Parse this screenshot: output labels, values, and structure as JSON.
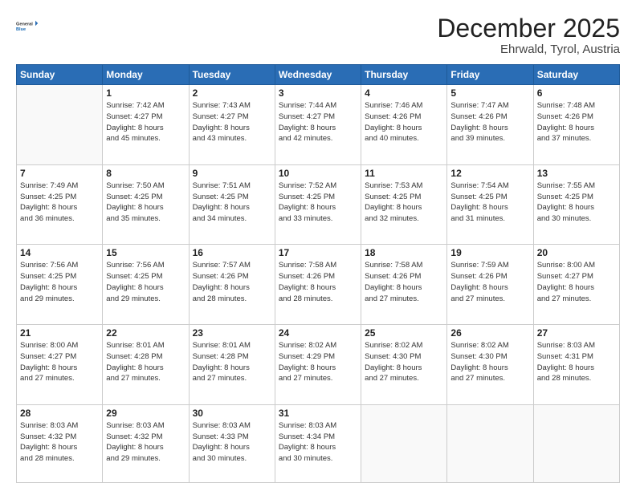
{
  "header": {
    "logo_line1": "General",
    "logo_line2": "Blue",
    "month_year": "December 2025",
    "location": "Ehrwald, Tyrol, Austria"
  },
  "weekdays": [
    "Sunday",
    "Monday",
    "Tuesday",
    "Wednesday",
    "Thursday",
    "Friday",
    "Saturday"
  ],
  "weeks": [
    [
      {
        "day": "",
        "info": ""
      },
      {
        "day": "1",
        "info": "Sunrise: 7:42 AM\nSunset: 4:27 PM\nDaylight: 8 hours\nand 45 minutes."
      },
      {
        "day": "2",
        "info": "Sunrise: 7:43 AM\nSunset: 4:27 PM\nDaylight: 8 hours\nand 43 minutes."
      },
      {
        "day": "3",
        "info": "Sunrise: 7:44 AM\nSunset: 4:27 PM\nDaylight: 8 hours\nand 42 minutes."
      },
      {
        "day": "4",
        "info": "Sunrise: 7:46 AM\nSunset: 4:26 PM\nDaylight: 8 hours\nand 40 minutes."
      },
      {
        "day": "5",
        "info": "Sunrise: 7:47 AM\nSunset: 4:26 PM\nDaylight: 8 hours\nand 39 minutes."
      },
      {
        "day": "6",
        "info": "Sunrise: 7:48 AM\nSunset: 4:26 PM\nDaylight: 8 hours\nand 37 minutes."
      }
    ],
    [
      {
        "day": "7",
        "info": "Sunrise: 7:49 AM\nSunset: 4:25 PM\nDaylight: 8 hours\nand 36 minutes."
      },
      {
        "day": "8",
        "info": "Sunrise: 7:50 AM\nSunset: 4:25 PM\nDaylight: 8 hours\nand 35 minutes."
      },
      {
        "day": "9",
        "info": "Sunrise: 7:51 AM\nSunset: 4:25 PM\nDaylight: 8 hours\nand 34 minutes."
      },
      {
        "day": "10",
        "info": "Sunrise: 7:52 AM\nSunset: 4:25 PM\nDaylight: 8 hours\nand 33 minutes."
      },
      {
        "day": "11",
        "info": "Sunrise: 7:53 AM\nSunset: 4:25 PM\nDaylight: 8 hours\nand 32 minutes."
      },
      {
        "day": "12",
        "info": "Sunrise: 7:54 AM\nSunset: 4:25 PM\nDaylight: 8 hours\nand 31 minutes."
      },
      {
        "day": "13",
        "info": "Sunrise: 7:55 AM\nSunset: 4:25 PM\nDaylight: 8 hours\nand 30 minutes."
      }
    ],
    [
      {
        "day": "14",
        "info": "Sunrise: 7:56 AM\nSunset: 4:25 PM\nDaylight: 8 hours\nand 29 minutes."
      },
      {
        "day": "15",
        "info": "Sunrise: 7:56 AM\nSunset: 4:25 PM\nDaylight: 8 hours\nand 29 minutes."
      },
      {
        "day": "16",
        "info": "Sunrise: 7:57 AM\nSunset: 4:26 PM\nDaylight: 8 hours\nand 28 minutes."
      },
      {
        "day": "17",
        "info": "Sunrise: 7:58 AM\nSunset: 4:26 PM\nDaylight: 8 hours\nand 28 minutes."
      },
      {
        "day": "18",
        "info": "Sunrise: 7:58 AM\nSunset: 4:26 PM\nDaylight: 8 hours\nand 27 minutes."
      },
      {
        "day": "19",
        "info": "Sunrise: 7:59 AM\nSunset: 4:26 PM\nDaylight: 8 hours\nand 27 minutes."
      },
      {
        "day": "20",
        "info": "Sunrise: 8:00 AM\nSunset: 4:27 PM\nDaylight: 8 hours\nand 27 minutes."
      }
    ],
    [
      {
        "day": "21",
        "info": "Sunrise: 8:00 AM\nSunset: 4:27 PM\nDaylight: 8 hours\nand 27 minutes."
      },
      {
        "day": "22",
        "info": "Sunrise: 8:01 AM\nSunset: 4:28 PM\nDaylight: 8 hours\nand 27 minutes."
      },
      {
        "day": "23",
        "info": "Sunrise: 8:01 AM\nSunset: 4:28 PM\nDaylight: 8 hours\nand 27 minutes."
      },
      {
        "day": "24",
        "info": "Sunrise: 8:02 AM\nSunset: 4:29 PM\nDaylight: 8 hours\nand 27 minutes."
      },
      {
        "day": "25",
        "info": "Sunrise: 8:02 AM\nSunset: 4:30 PM\nDaylight: 8 hours\nand 27 minutes."
      },
      {
        "day": "26",
        "info": "Sunrise: 8:02 AM\nSunset: 4:30 PM\nDaylight: 8 hours\nand 27 minutes."
      },
      {
        "day": "27",
        "info": "Sunrise: 8:03 AM\nSunset: 4:31 PM\nDaylight: 8 hours\nand 28 minutes."
      }
    ],
    [
      {
        "day": "28",
        "info": "Sunrise: 8:03 AM\nSunset: 4:32 PM\nDaylight: 8 hours\nand 28 minutes."
      },
      {
        "day": "29",
        "info": "Sunrise: 8:03 AM\nSunset: 4:32 PM\nDaylight: 8 hours\nand 29 minutes."
      },
      {
        "day": "30",
        "info": "Sunrise: 8:03 AM\nSunset: 4:33 PM\nDaylight: 8 hours\nand 30 minutes."
      },
      {
        "day": "31",
        "info": "Sunrise: 8:03 AM\nSunset: 4:34 PM\nDaylight: 8 hours\nand 30 minutes."
      },
      {
        "day": "",
        "info": ""
      },
      {
        "day": "",
        "info": ""
      },
      {
        "day": "",
        "info": ""
      }
    ]
  ]
}
